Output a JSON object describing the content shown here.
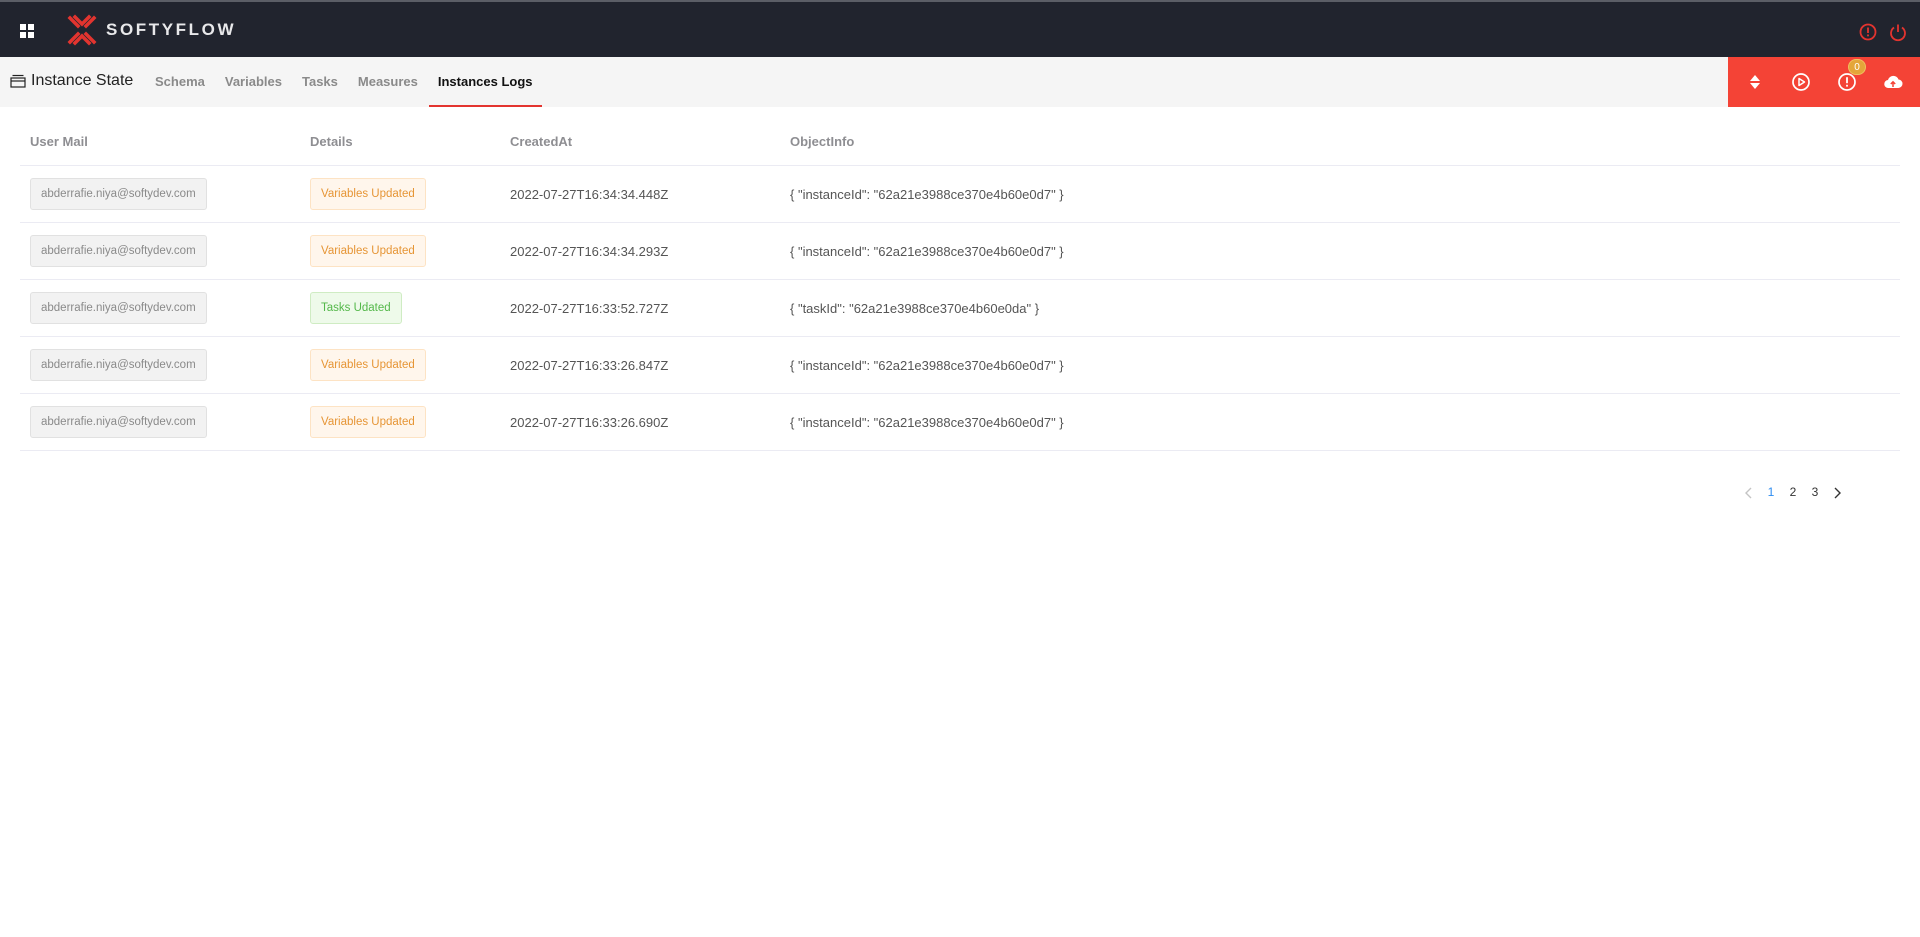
{
  "app": {
    "brand": "SOFTYFLOW",
    "colors": {
      "topbar": "#21242e",
      "accent": "#f44336",
      "active_tab_underline": "#e3342f",
      "warning_tag": "#e69535",
      "success_tag": "#54b84a",
      "pager_active": "#2d8cf0",
      "badge": "#e4a63a"
    }
  },
  "header": {
    "icons": [
      "apps-grid-icon",
      "alert-circle-icon",
      "power-icon"
    ]
  },
  "subheader": {
    "title": "Instance State",
    "title_icon": "window-icon",
    "tabs": [
      {
        "label": "Schema",
        "active": false
      },
      {
        "label": "Variables",
        "active": false
      },
      {
        "label": "Tasks",
        "active": false
      },
      {
        "label": "Measures",
        "active": false
      },
      {
        "label": "Instances Logs",
        "active": true
      }
    ],
    "actions": [
      {
        "icon": "sort-icon"
      },
      {
        "icon": "play-circle-icon"
      },
      {
        "icon": "alert-circle-icon",
        "badge": "0"
      },
      {
        "icon": "cloud-upload-icon"
      }
    ]
  },
  "table": {
    "columns": [
      "User Mail",
      "Details",
      "CreatedAt",
      "ObjectInfo"
    ],
    "rows": [
      {
        "user_mail": "abderrafie.niya@softydev.com",
        "details": "Variables Updated",
        "details_type": "orange",
        "created_at": "2022-07-27T16:34:34.448Z",
        "object_info": "{ \"instanceId\": \"62a21e3988ce370e4b60e0d7\" }"
      },
      {
        "user_mail": "abderrafie.niya@softydev.com",
        "details": "Variables Updated",
        "details_type": "orange",
        "created_at": "2022-07-27T16:34:34.293Z",
        "object_info": "{ \"instanceId\": \"62a21e3988ce370e4b60e0d7\" }"
      },
      {
        "user_mail": "abderrafie.niya@softydev.com",
        "details": "Tasks Udated",
        "details_type": "green",
        "created_at": "2022-07-27T16:33:52.727Z",
        "object_info": "{ \"taskId\": \"62a21e3988ce370e4b60e0da\" }"
      },
      {
        "user_mail": "abderrafie.niya@softydev.com",
        "details": "Variables Updated",
        "details_type": "orange",
        "created_at": "2022-07-27T16:33:26.847Z",
        "object_info": "{ \"instanceId\": \"62a21e3988ce370e4b60e0d7\" }"
      },
      {
        "user_mail": "abderrafie.niya@softydev.com",
        "details": "Variables Updated",
        "details_type": "orange",
        "created_at": "2022-07-27T16:33:26.690Z",
        "object_info": "{ \"instanceId\": \"62a21e3988ce370e4b60e0d7\" }"
      }
    ]
  },
  "pagination": {
    "current": "1",
    "pages": [
      "1",
      "2",
      "3"
    ],
    "prev_disabled": true
  }
}
